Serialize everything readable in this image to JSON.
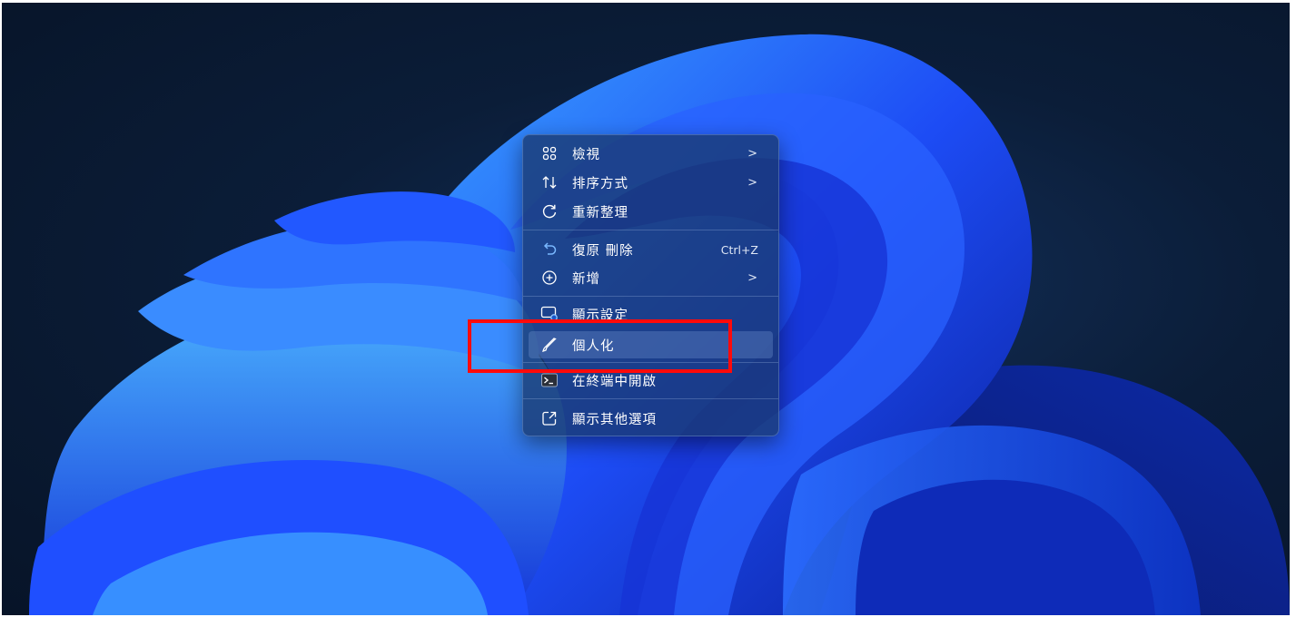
{
  "context_menu": {
    "items": [
      {
        "label": "檢視",
        "icon": "view-grid-icon",
        "submenu": true
      },
      {
        "label": "排序方式",
        "icon": "sort-icon",
        "submenu": true
      },
      {
        "label": "重新整理",
        "icon": "refresh-icon",
        "submenu": false
      },
      {
        "label": "復原 刪除",
        "icon": "undo-icon",
        "shortcut": "Ctrl+Z"
      },
      {
        "label": "新增",
        "icon": "add-circle-icon",
        "submenu": true
      },
      {
        "label": "顯示設定",
        "icon": "display-settings-icon",
        "submenu": false
      },
      {
        "label": "個人化",
        "icon": "brush-icon",
        "submenu": false,
        "selected": true
      },
      {
        "label": "在終端中開啟",
        "icon": "terminal-icon",
        "submenu": false
      },
      {
        "label": "顯示其他選項",
        "icon": "more-options-icon",
        "submenu": false
      }
    ],
    "submenu_arrow": ">"
  },
  "annotation": {
    "color": "#ff0a0a"
  },
  "colors": {
    "desktop_bg": "#0b1d38",
    "bloom": "#1f4fff"
  }
}
